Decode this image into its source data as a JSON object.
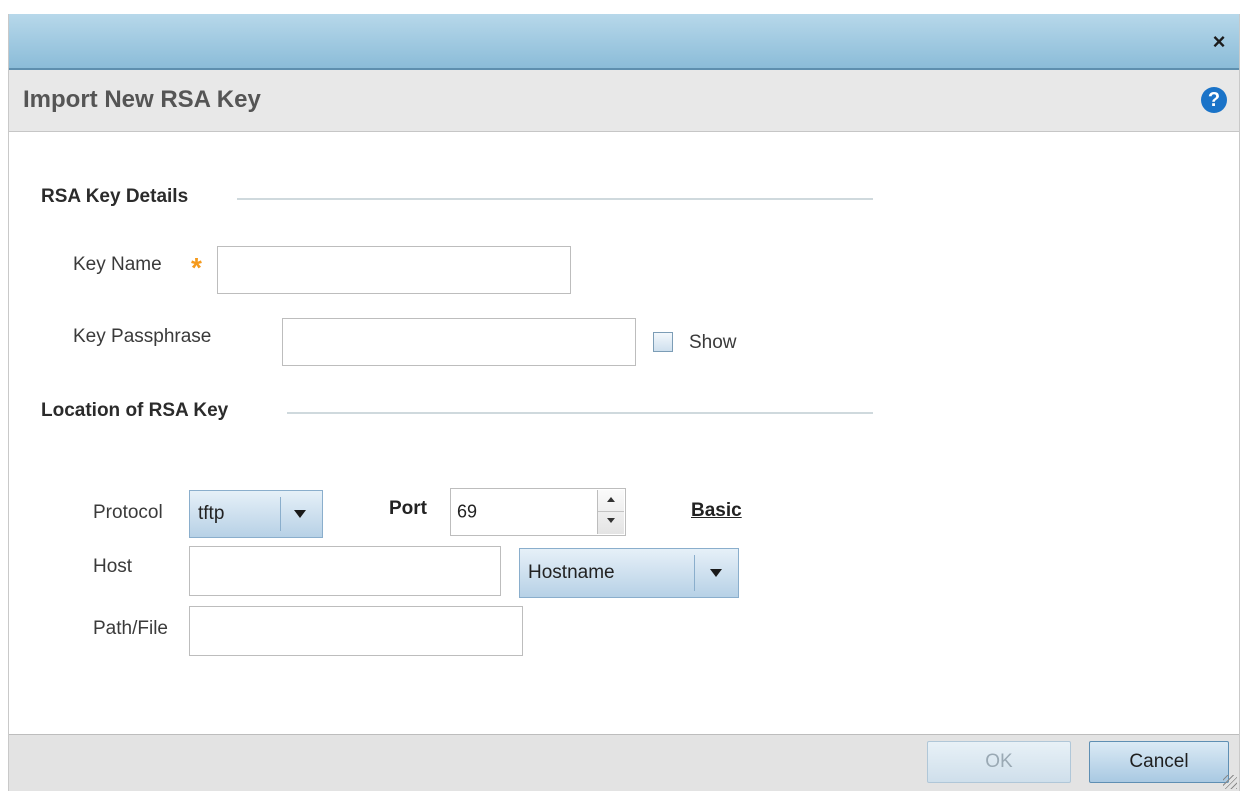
{
  "dialog": {
    "title": "Import New RSA Key",
    "close_icon": "close-icon",
    "help_icon": "help-icon",
    "help_glyph": "?",
    "close_glyph": "×"
  },
  "key_details": {
    "section_title": "RSA Key Details",
    "key_name_label": "Key Name",
    "key_name_required_mark": "*",
    "key_name_value": "",
    "key_passphrase_label": "Key Passphrase",
    "key_passphrase_value": "",
    "show_label": "Show",
    "show_checked": false
  },
  "location": {
    "section_title": "Location of RSA Key",
    "protocol_label": "Protocol",
    "protocol_value": "tftp",
    "port_label": "Port",
    "port_value": "69",
    "basic_link": "Basic",
    "host_label": "Host",
    "host_value": "",
    "host_type_value": "Hostname",
    "path_label": "Path/File",
    "path_value": ""
  },
  "footer": {
    "ok_label": "OK",
    "cancel_label": "Cancel"
  },
  "colors": {
    "titlebar": "#8bbcd8",
    "required_star": "#f59a1c",
    "help_icon": "#1a73c8"
  }
}
